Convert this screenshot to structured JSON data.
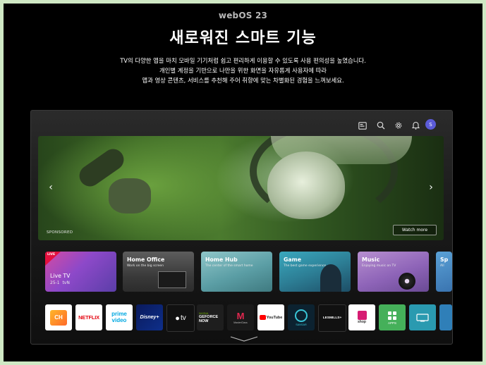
{
  "header": {
    "kicker": "webOS 23",
    "headline": "새로워진 스마트 기능",
    "desc_line1": "TV의 다양한 앱을 마치 모바일 기기처럼 쉽고 편리하게 이용할 수 있도록 사용 편의성을 높였습니다.",
    "desc_line2": "개인별 계정을 기반으로 나만을 위한 화면을 자유롭게 사용자에 따라",
    "desc_line3": "앱과 영상 콘텐츠, 서비스를 추천해 주어 취향에 맞는 차별화된 경험을 느껴보세요."
  },
  "tv": {
    "topbar_icons": [
      "input-source-icon",
      "search-icon",
      "settings-icon",
      "notification-icon"
    ],
    "profile_initial": "S",
    "hero": {
      "sponsored_label": "SPONSORED",
      "watch_label": "Watch more"
    },
    "cards": [
      {
        "title": "Live TV",
        "badge": "LIVE",
        "channel": "25-1",
        "network": "tvN"
      },
      {
        "title": "Home Office",
        "subtitle": "Work on the big screen"
      },
      {
        "title": "Home Hub",
        "subtitle": "The center of the smart home"
      },
      {
        "title": "Game",
        "subtitle": "The best game experience"
      },
      {
        "title": "Music",
        "subtitle": "Enjoying music on TV"
      },
      {
        "title": "Sp",
        "subtitle": "All"
      }
    ],
    "apps": [
      {
        "label": "CH",
        "name": "LG Channels"
      },
      {
        "label": "NETFLIX",
        "name": "Netflix"
      },
      {
        "label1": "prime",
        "label2": "video",
        "name": "Prime Video"
      },
      {
        "label": "Disney+",
        "name": "Disney+"
      },
      {
        "label": "tv",
        "name": "Apple TV"
      },
      {
        "label1": "NVIDIA",
        "label2": "GEFORCE",
        "label3": "NOW",
        "name": "GeForce NOW"
      },
      {
        "label": "MasterClass",
        "name": "MasterClass"
      },
      {
        "label": "YouTube",
        "name": "YouTube"
      },
      {
        "label": "SANSAR",
        "name": "Sansar"
      },
      {
        "label": "LESMILLS+",
        "name": "Les Mills+"
      },
      {
        "label": "shop",
        "name": "LG Shop"
      },
      {
        "label": "APPS",
        "name": "Apps"
      }
    ]
  },
  "colors": {
    "page_border": "#cfe8c4",
    "background": "#000000",
    "profile": "#5b5bd8",
    "live_badge": "#e4103e",
    "netflix": "#e50914",
    "prime": "#00a8e1"
  }
}
